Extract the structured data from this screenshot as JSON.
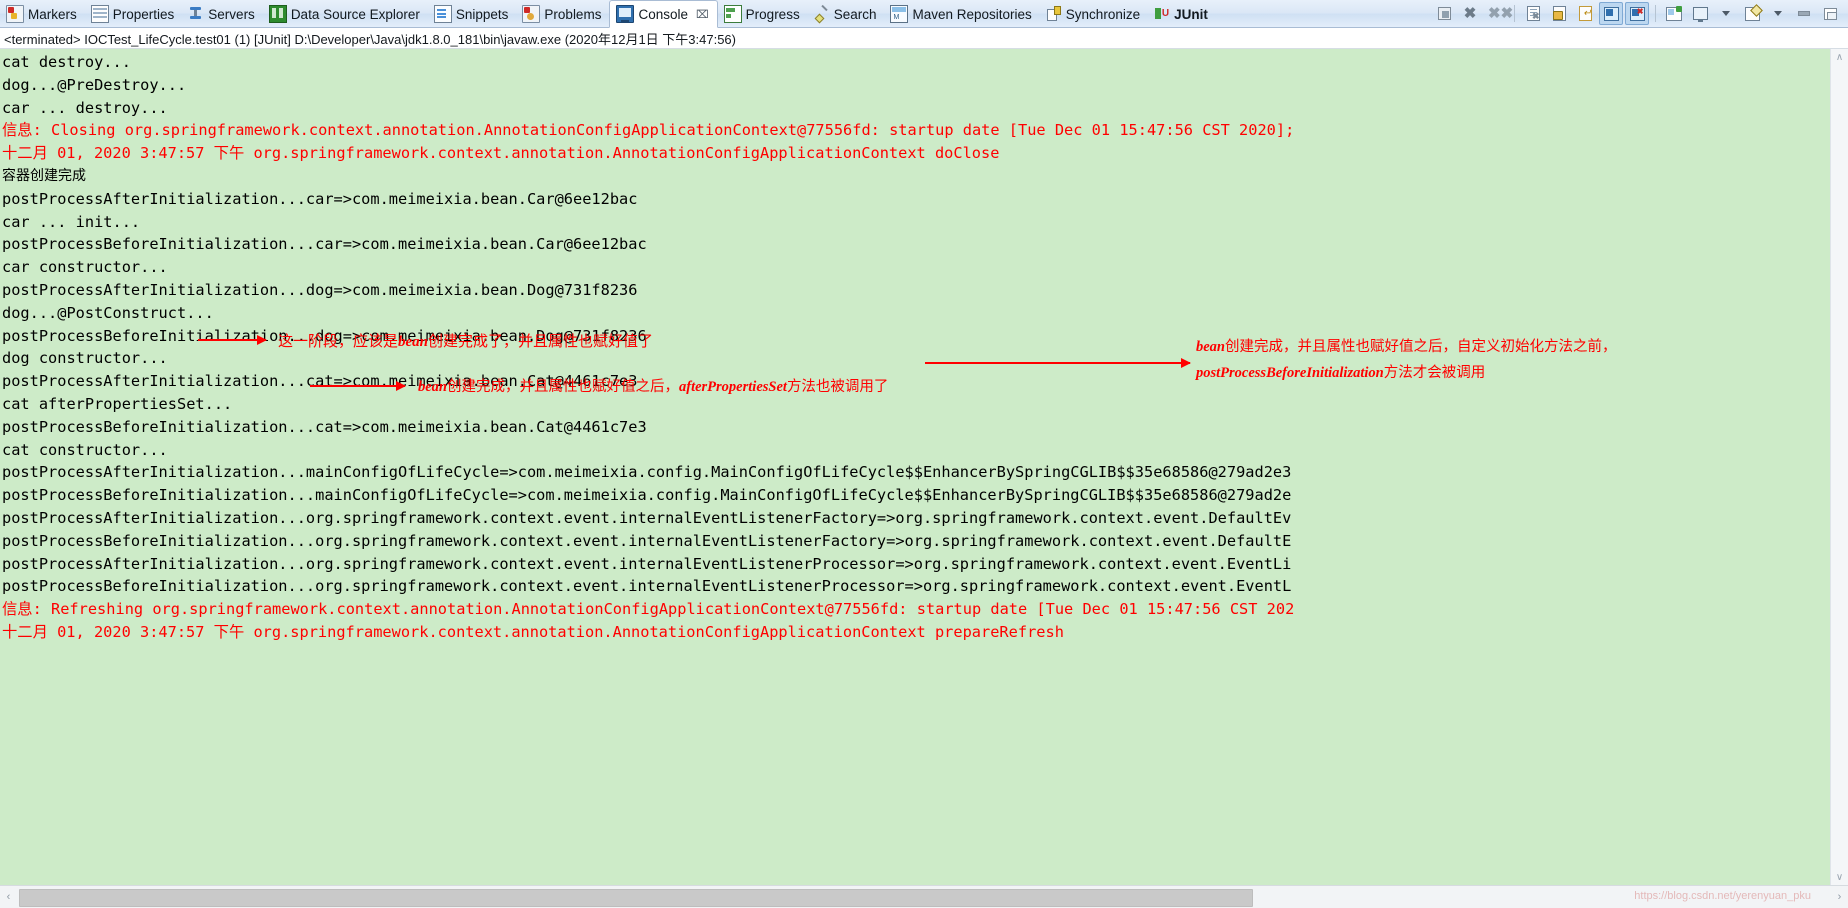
{
  "tabs": [
    {
      "label": "Markers",
      "icon": "marker-icon",
      "active": false,
      "bold": false
    },
    {
      "label": "Properties",
      "icon": "properties-icon",
      "active": false,
      "bold": false
    },
    {
      "label": "Servers",
      "icon": "servers-icon",
      "active": false,
      "bold": false
    },
    {
      "label": "Data Source Explorer",
      "icon": "data-source-explorer-icon",
      "active": false,
      "bold": false
    },
    {
      "label": "Snippets",
      "icon": "snippets-icon",
      "active": false,
      "bold": false
    },
    {
      "label": "Problems",
      "icon": "problems-icon",
      "active": false,
      "bold": false
    },
    {
      "label": "Console",
      "icon": "console-icon",
      "active": true,
      "bold": false
    },
    {
      "label": "Progress",
      "icon": "progress-icon",
      "active": false,
      "bold": false
    },
    {
      "label": "Search",
      "icon": "search-icon",
      "active": false,
      "bold": false
    },
    {
      "label": "Maven Repositories",
      "icon": "maven-repositories-icon",
      "active": false,
      "bold": false
    },
    {
      "label": "Synchronize",
      "icon": "synchronize-icon",
      "active": false,
      "bold": false
    },
    {
      "label": "JUnit",
      "icon": "junit-icon",
      "active": false,
      "bold": true
    }
  ],
  "tab_close_glyph": "⌧",
  "toolbar": {
    "terminate": "Terminate",
    "remove_launch": "Remove Launch",
    "remove_all_terminated": "Remove All Terminated Launches",
    "clear_console": "Clear Console",
    "scroll_lock": "Scroll Lock",
    "word_wrap": "Word Wrap",
    "show_console_on_output": "Show Console When Standard Out Changes",
    "show_console_on_error": "Show Console When Standard Error Changes",
    "open_console": "Open Console",
    "display_selected_console": "Display Selected Console",
    "pin_console": "Pin Console",
    "minimize": "Minimize",
    "maximize": "Maximize",
    "dropdown_glyph": "▼"
  },
  "launch": {
    "text": "<terminated> IOCTest_LifeCycle.test01 (1) [JUnit] D:\\Developer\\Java\\jdk1.8.0_181\\bin\\javaw.exe (2020年12月1日 下午3:47:56)"
  },
  "console": {
    "background": "#cdebc8",
    "error_color": "#ff0000",
    "stdout_color": "#000000",
    "lines": [
      {
        "stream": "err",
        "text": "十二月 01, 2020 3:47:57 下午 org.springframework.context.annotation.AnnotationConfigApplicationContext prepareRefresh"
      },
      {
        "stream": "err",
        "text": "信息: Refreshing org.springframework.context.annotation.AnnotationConfigApplicationContext@77556fd: startup date [Tue Dec 01 15:47:56 CST 202"
      },
      {
        "stream": "out",
        "text": "postProcessBeforeInitialization...org.springframework.context.event.internalEventListenerProcessor=>org.springframework.context.event.EventL"
      },
      {
        "stream": "out",
        "text": "postProcessAfterInitialization...org.springframework.context.event.internalEventListenerProcessor=>org.springframework.context.event.EventLi"
      },
      {
        "stream": "out",
        "text": "postProcessBeforeInitialization...org.springframework.context.event.internalEventListenerFactory=>org.springframework.context.event.DefaultE"
      },
      {
        "stream": "out",
        "text": "postProcessAfterInitialization...org.springframework.context.event.internalEventListenerFactory=>org.springframework.context.event.DefaultEv"
      },
      {
        "stream": "out",
        "text": "postProcessBeforeInitialization...mainConfigOfLifeCycle=>com.meimeixia.config.MainConfigOfLifeCycle$$EnhancerBySpringCGLIB$$35e68586@279ad2e"
      },
      {
        "stream": "out",
        "text": "postProcessAfterInitialization...mainConfigOfLifeCycle=>com.meimeixia.config.MainConfigOfLifeCycle$$EnhancerBySpringCGLIB$$35e68586@279ad2e3"
      },
      {
        "stream": "out",
        "text": "cat constructor..."
      },
      {
        "stream": "out",
        "text": "postProcessBeforeInitialization...cat=>com.meimeixia.bean.Cat@4461c7e3"
      },
      {
        "stream": "out",
        "text": "cat afterPropertiesSet..."
      },
      {
        "stream": "out",
        "text": "postProcessAfterInitialization...cat=>com.meimeixia.bean.Cat@4461c7e3"
      },
      {
        "stream": "out",
        "text": "dog constructor..."
      },
      {
        "stream": "out",
        "text": "postProcessBeforeInitialization...dog=>com.meimeixia.bean.Dog@731f8236"
      },
      {
        "stream": "out",
        "text": "dog...@PostConstruct..."
      },
      {
        "stream": "out",
        "text": "postProcessAfterInitialization...dog=>com.meimeixia.bean.Dog@731f8236"
      },
      {
        "stream": "out",
        "text": "car constructor..."
      },
      {
        "stream": "out",
        "text": "postProcessBeforeInitialization...car=>com.meimeixia.bean.Car@6ee12bac"
      },
      {
        "stream": "out",
        "text": "car ... init..."
      },
      {
        "stream": "out",
        "text": "postProcessAfterInitialization...car=>com.meimeixia.bean.Car@6ee12bac"
      },
      {
        "stream": "out",
        "cjk": true,
        "text": "容器创建完成"
      },
      {
        "stream": "err",
        "text": "十二月 01, 2020 3:47:57 下午 org.springframework.context.annotation.AnnotationConfigApplicationContext doClose"
      },
      {
        "stream": "err",
        "text": "信息: Closing org.springframework.context.annotation.AnnotationConfigApplicationContext@77556fd: startup date [Tue Dec 01 15:47:56 CST 2020];"
      },
      {
        "stream": "out",
        "text": "car ... destroy..."
      },
      {
        "stream": "out",
        "text": "dog...@PreDestroy..."
      },
      {
        "stream": "out",
        "text": "cat destroy..."
      }
    ]
  },
  "annotations": [
    {
      "id": "anno-cat-constructor",
      "prefix": "这一阶段，应该是",
      "emphasis": "bean",
      "suffix": "创建完成了，并且属性也赋好值了"
    },
    {
      "id": "anno-after-properties-set",
      "prefix": "",
      "emphasis": "bean",
      "suffix": "创建完成，并且属性也赋好值之后，",
      "emphasis2": "afterPropertiesSet",
      "suffix2": "方法也被调用了"
    },
    {
      "id": "anno-post-process-before",
      "line1_emphasis": "bean",
      "line1_text": "创建完成，并且属性也赋好值之后，自定义初始化方法之前，",
      "line2_emphasis": "postProcessBeforeInitialization",
      "line2_text": "方法才会被调用"
    }
  ],
  "scrollbars": {
    "v_up_glyph": "∧",
    "v_down_glyph": "∨",
    "h_left_glyph": "‹",
    "h_right_glyph": "›"
  },
  "watermark": "https://blog.csdn.net/yerenyuan_pku"
}
